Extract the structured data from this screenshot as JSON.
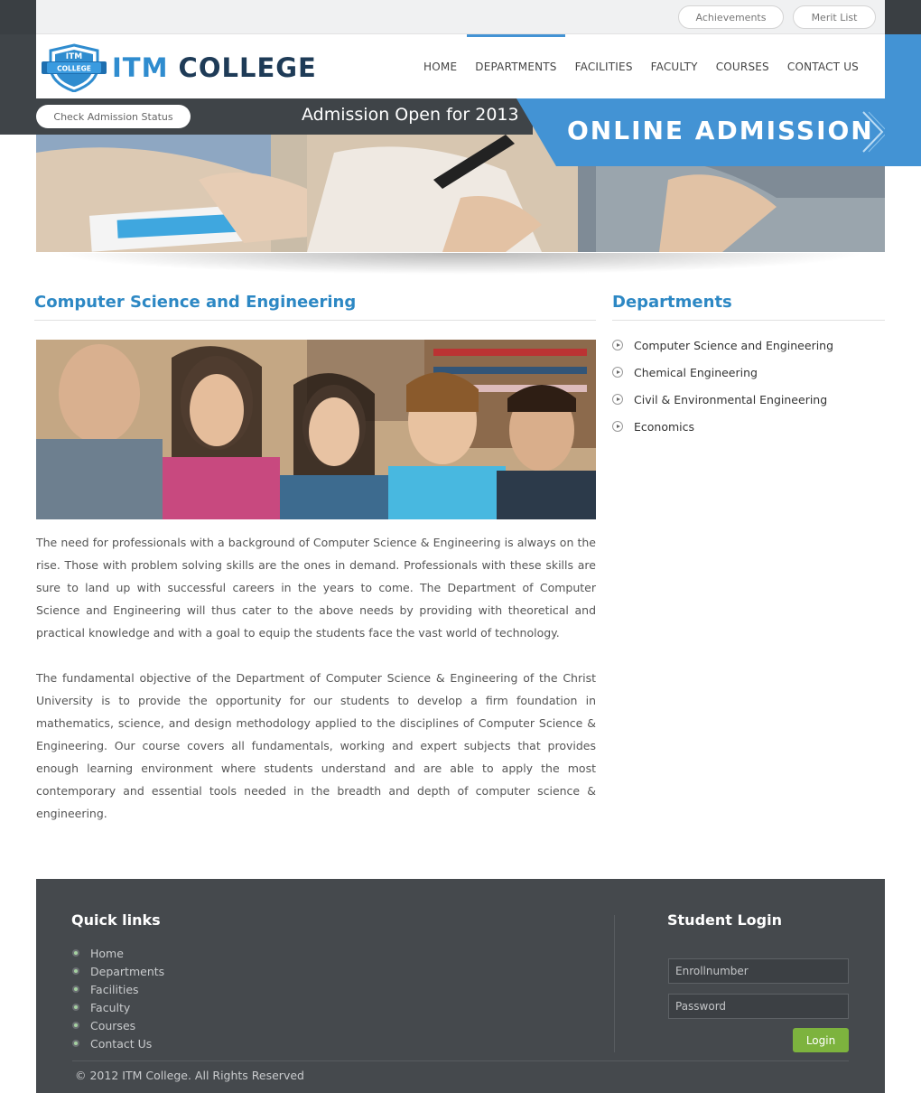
{
  "topbar": {
    "achievements_label": "Achievements",
    "merit_list_label": "Merit List"
  },
  "logo": {
    "badge_line1": "ITM",
    "badge_line2": "COLLEGE",
    "word1": "ITM",
    "word2": "COLLEGE"
  },
  "nav": {
    "items": [
      {
        "label": "HOME"
      },
      {
        "label": "DEPARTMENTS",
        "active": true
      },
      {
        "label": "FACILITIES"
      },
      {
        "label": "FACULTY"
      },
      {
        "label": "COURSES"
      },
      {
        "label": "CONTACT US"
      }
    ]
  },
  "banner": {
    "check_status_label": "Check Admission Status",
    "admission_open_text": "Admission Open for 2013",
    "online_admission_label": "ONLINE ADMISSION"
  },
  "main": {
    "title": "Computer Science and Engineering",
    "paragraphs": [
      "The need for professionals with a background of Computer Science & Engineering is always on the rise. Those with problem solving skills are the ones in demand. Professionals with these skills are sure to land up with successful careers in the years to come. The Department of Computer Science and Engineering will thus cater to the above needs by providing with theoretical and practical knowledge and with a goal to equip the students face the vast world of technology.",
      "The fundamental objective of the Department of Computer Science & Engineering of the Christ University is to provide the opportunity for our students to develop a firm foundation in mathematics, science, and design methodology applied to the disciplines of Computer Science & Engineering. Our course covers all fundamentals, working and expert subjects that provides enough learning environment where students understand and are able to apply the most contemporary and essential tools needed in the breadth and depth of computer science & engineering."
    ]
  },
  "sidebar": {
    "title": "Departments",
    "items": [
      {
        "label": "Computer Science and Engineering"
      },
      {
        "label": "Chemical Engineering"
      },
      {
        "label": "Civil & Environmental Engineering"
      },
      {
        "label": "Economics"
      }
    ]
  },
  "footer": {
    "quick_links_title": "Quick links",
    "quick_links": [
      {
        "label": "Home"
      },
      {
        "label": "Departments"
      },
      {
        "label": "Facilities"
      },
      {
        "label": "Faculty"
      },
      {
        "label": "Courses"
      },
      {
        "label": "Contact Us"
      }
    ],
    "student_login_title": "Student Login",
    "enroll_placeholder": "Enrollnumber",
    "password_placeholder": "Password",
    "login_label": "Login",
    "copyright": "© 2012 ITM College. All Rights Reserved"
  },
  "colors": {
    "accent_blue": "#4393d4",
    "title_blue": "#2d88c4",
    "dark_gray": "#45494d",
    "login_green": "#7db33e"
  }
}
